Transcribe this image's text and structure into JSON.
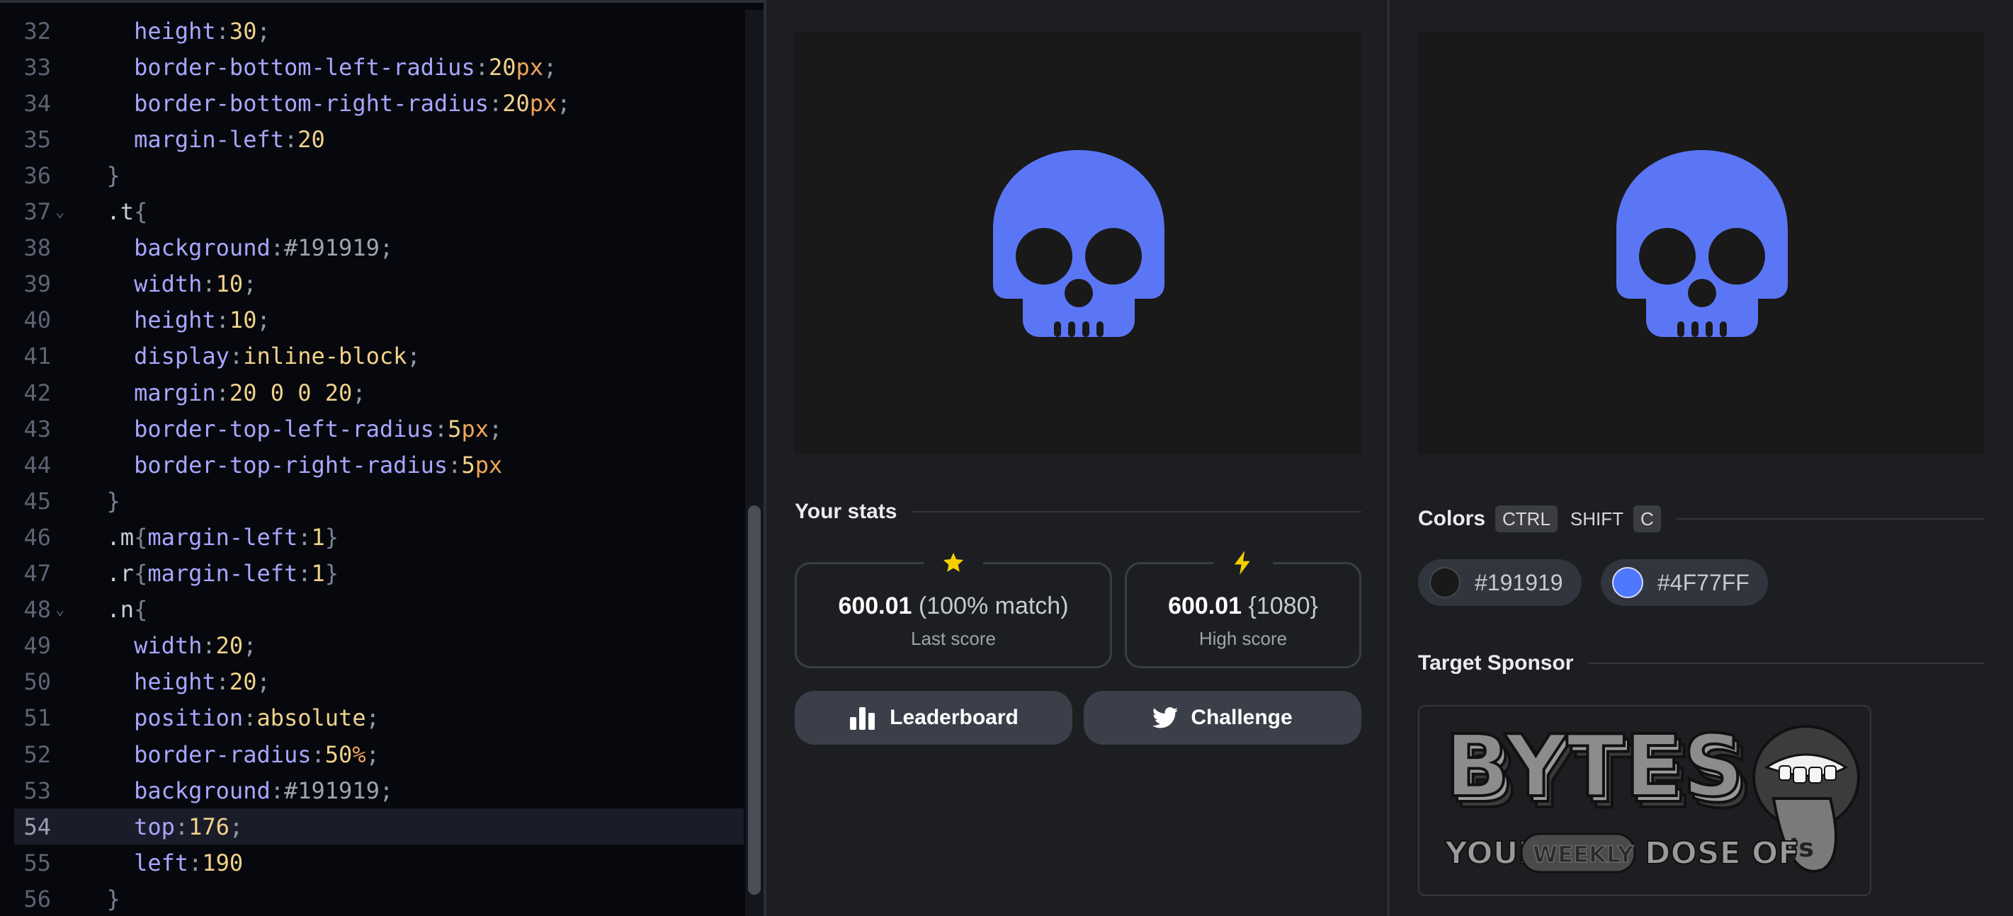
{
  "editor": {
    "lines": [
      {
        "n": "32",
        "fold": false,
        "active": false,
        "tokens": [
          [
            "ind2",
            ""
          ],
          [
            "c-prop",
            "height"
          ],
          [
            "c-punc",
            ":"
          ],
          [
            "c-num",
            "30"
          ],
          [
            "c-punc",
            ";"
          ]
        ]
      },
      {
        "n": "33",
        "fold": false,
        "active": false,
        "tokens": [
          [
            "ind2",
            ""
          ],
          [
            "c-prop",
            "border-bottom-left-radius"
          ],
          [
            "c-punc",
            ":"
          ],
          [
            "c-num",
            "20"
          ],
          [
            "c-unit",
            "px"
          ],
          [
            "c-punc",
            ";"
          ]
        ]
      },
      {
        "n": "34",
        "fold": false,
        "active": false,
        "tokens": [
          [
            "ind2",
            ""
          ],
          [
            "c-prop",
            "border-bottom-right-radius"
          ],
          [
            "c-punc",
            ":"
          ],
          [
            "c-num",
            "20"
          ],
          [
            "c-unit",
            "px"
          ],
          [
            "c-punc",
            ";"
          ]
        ]
      },
      {
        "n": "35",
        "fold": false,
        "active": false,
        "tokens": [
          [
            "ind2",
            ""
          ],
          [
            "c-prop",
            "margin-left"
          ],
          [
            "c-punc",
            ":"
          ],
          [
            "c-num",
            "20"
          ]
        ]
      },
      {
        "n": "36",
        "fold": false,
        "active": false,
        "tokens": [
          [
            "ind1",
            ""
          ],
          [
            "c-brace",
            "}"
          ]
        ]
      },
      {
        "n": "37",
        "fold": true,
        "active": false,
        "tokens": [
          [
            "ind1",
            ""
          ],
          [
            "c-sel",
            ".t"
          ],
          [
            "c-brace",
            "{"
          ]
        ]
      },
      {
        "n": "38",
        "fold": false,
        "active": false,
        "tokens": [
          [
            "ind2",
            ""
          ],
          [
            "c-prop",
            "background"
          ],
          [
            "c-punc",
            ":"
          ],
          [
            "c-hash",
            "#191919"
          ],
          [
            "c-punc",
            ";"
          ]
        ]
      },
      {
        "n": "39",
        "fold": false,
        "active": false,
        "tokens": [
          [
            "ind2",
            ""
          ],
          [
            "c-prop",
            "width"
          ],
          [
            "c-punc",
            ":"
          ],
          [
            "c-num",
            "10"
          ],
          [
            "c-punc",
            ";"
          ]
        ]
      },
      {
        "n": "40",
        "fold": false,
        "active": false,
        "tokens": [
          [
            "ind2",
            ""
          ],
          [
            "c-prop",
            "height"
          ],
          [
            "c-punc",
            ":"
          ],
          [
            "c-num",
            "10"
          ],
          [
            "c-punc",
            ";"
          ]
        ]
      },
      {
        "n": "41",
        "fold": false,
        "active": false,
        "tokens": [
          [
            "ind2",
            ""
          ],
          [
            "c-prop",
            "display"
          ],
          [
            "c-punc",
            ":"
          ],
          [
            "c-kw",
            "inline-block"
          ],
          [
            "c-punc",
            ";"
          ]
        ]
      },
      {
        "n": "42",
        "fold": false,
        "active": false,
        "tokens": [
          [
            "ind2",
            ""
          ],
          [
            "c-prop",
            "margin"
          ],
          [
            "c-punc",
            ":"
          ],
          [
            "c-num",
            "20 0 0 20"
          ],
          [
            "c-punc",
            ";"
          ]
        ]
      },
      {
        "n": "43",
        "fold": false,
        "active": false,
        "tokens": [
          [
            "ind2",
            ""
          ],
          [
            "c-prop",
            "border-top-left-radius"
          ],
          [
            "c-punc",
            ":"
          ],
          [
            "c-num",
            "5"
          ],
          [
            "c-unit",
            "px"
          ],
          [
            "c-punc",
            ";"
          ]
        ]
      },
      {
        "n": "44",
        "fold": false,
        "active": false,
        "tokens": [
          [
            "ind2",
            ""
          ],
          [
            "c-prop",
            "border-top-right-radius"
          ],
          [
            "c-punc",
            ":"
          ],
          [
            "c-num",
            "5"
          ],
          [
            "c-unit",
            "px"
          ]
        ]
      },
      {
        "n": "45",
        "fold": false,
        "active": false,
        "tokens": [
          [
            "ind1",
            ""
          ],
          [
            "c-brace",
            "}"
          ]
        ]
      },
      {
        "n": "46",
        "fold": false,
        "active": false,
        "tokens": [
          [
            "ind1",
            ""
          ],
          [
            "c-sel",
            ".m"
          ],
          [
            "c-brace",
            "{"
          ],
          [
            "c-prop",
            "margin-left"
          ],
          [
            "c-punc",
            ":"
          ],
          [
            "c-num",
            "1"
          ],
          [
            "c-brace",
            "}"
          ]
        ]
      },
      {
        "n": "47",
        "fold": false,
        "active": false,
        "tokens": [
          [
            "ind1",
            ""
          ],
          [
            "c-sel",
            ".r"
          ],
          [
            "c-brace",
            "{"
          ],
          [
            "c-prop",
            "margin-left"
          ],
          [
            "c-punc",
            ":"
          ],
          [
            "c-num",
            "1"
          ],
          [
            "c-brace",
            "}"
          ]
        ]
      },
      {
        "n": "48",
        "fold": true,
        "active": false,
        "tokens": [
          [
            "ind1",
            ""
          ],
          [
            "c-sel",
            ".n"
          ],
          [
            "c-brace",
            "{"
          ]
        ]
      },
      {
        "n": "49",
        "fold": false,
        "active": false,
        "tokens": [
          [
            "ind2",
            ""
          ],
          [
            "c-prop",
            "width"
          ],
          [
            "c-punc",
            ":"
          ],
          [
            "c-num",
            "20"
          ],
          [
            "c-punc",
            ";"
          ]
        ]
      },
      {
        "n": "50",
        "fold": false,
        "active": false,
        "tokens": [
          [
            "ind2",
            ""
          ],
          [
            "c-prop",
            "height"
          ],
          [
            "c-punc",
            ":"
          ],
          [
            "c-num",
            "20"
          ],
          [
            "c-punc",
            ";"
          ]
        ]
      },
      {
        "n": "51",
        "fold": false,
        "active": false,
        "tokens": [
          [
            "ind2",
            ""
          ],
          [
            "c-prop",
            "position"
          ],
          [
            "c-punc",
            ":"
          ],
          [
            "c-kw",
            "absolute"
          ],
          [
            "c-punc",
            ";"
          ]
        ]
      },
      {
        "n": "52",
        "fold": false,
        "active": false,
        "tokens": [
          [
            "ind2",
            ""
          ],
          [
            "c-prop",
            "border-radius"
          ],
          [
            "c-punc",
            ":"
          ],
          [
            "c-num",
            "50"
          ],
          [
            "c-unit",
            "%"
          ],
          [
            "c-punc",
            ";"
          ]
        ]
      },
      {
        "n": "53",
        "fold": false,
        "active": false,
        "tokens": [
          [
            "ind2",
            ""
          ],
          [
            "c-prop",
            "background"
          ],
          [
            "c-punc",
            ":"
          ],
          [
            "c-hash",
            "#191919"
          ],
          [
            "c-punc",
            ";"
          ]
        ]
      },
      {
        "n": "54",
        "fold": false,
        "active": true,
        "tokens": [
          [
            "ind2",
            ""
          ],
          [
            "c-prop",
            "top"
          ],
          [
            "c-punc",
            ":"
          ],
          [
            "c-num",
            "176"
          ],
          [
            "c-punc",
            ";"
          ]
        ]
      },
      {
        "n": "55",
        "fold": false,
        "active": false,
        "tokens": [
          [
            "ind2",
            ""
          ],
          [
            "c-prop",
            "left"
          ],
          [
            "c-punc",
            ":"
          ],
          [
            "c-num",
            "190"
          ]
        ]
      },
      {
        "n": "56",
        "fold": false,
        "active": false,
        "tokens": [
          [
            "ind1",
            ""
          ],
          [
            "c-brace",
            "}"
          ]
        ]
      }
    ]
  },
  "stats": {
    "heading": "Your stats",
    "last": {
      "value": "600.01",
      "detail": "(100% match)",
      "label": "Last score",
      "icon": "star-icon"
    },
    "high": {
      "value": "600.01",
      "detail": "{1080}",
      "label": "High score",
      "icon": "lightning-icon"
    },
    "leaderboard_label": "Leaderboard",
    "challenge_label": "Challenge"
  },
  "colors": {
    "heading": "Colors",
    "shortcut": [
      "CTRL",
      "SHIFT",
      "C"
    ],
    "items": [
      {
        "hex": "#191919",
        "label": "#191919"
      },
      {
        "hex": "#4F77FF",
        "label": "#4F77FF"
      }
    ]
  },
  "sponsor": {
    "heading": "Target Sponsor",
    "logo_title": "BYTES",
    "tagline_your": "YOUR",
    "tagline_weekly": "WEEKLY",
    "tagline_dose": "DOSE OF",
    "tagline_js": "Js"
  },
  "palette": {
    "skull": "#5b76f5",
    "bg": "#191919",
    "star": "#f5d000"
  }
}
